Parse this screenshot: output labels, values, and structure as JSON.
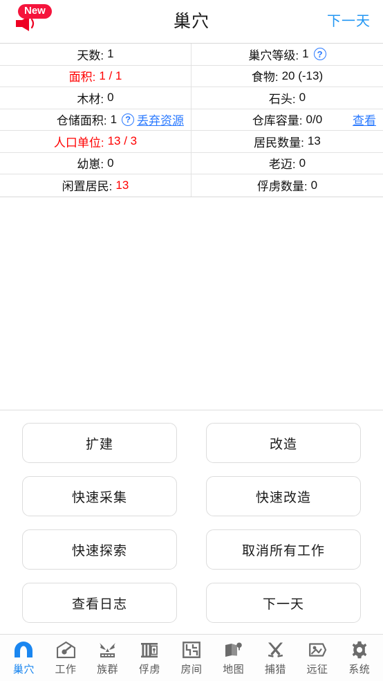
{
  "header": {
    "title": "巢穴",
    "next_day_label": "下一天",
    "badge": "New",
    "badge_icon": "megaphone-icon",
    "badge_color": "#f5143c",
    "link_color": "#2196f3"
  },
  "stats": {
    "help_glyph": "?",
    "rows": [
      {
        "left": {
          "label": "天数:",
          "value": "1",
          "alert": false,
          "help": false,
          "link": null
        },
        "right": {
          "label": "巢穴等级:",
          "value": "1",
          "alert": false,
          "help": true,
          "link": null
        }
      },
      {
        "left": {
          "label": "面积:",
          "value": "1 / 1",
          "alert": true,
          "help": false,
          "link": null
        },
        "right": {
          "label": "食物:",
          "value": "20 (-13)",
          "alert": false,
          "help": false,
          "link": null
        }
      },
      {
        "left": {
          "label": "木材:",
          "value": "0",
          "alert": false,
          "help": false,
          "link": null
        },
        "right": {
          "label": "石头:",
          "value": "0",
          "alert": false,
          "help": false,
          "link": null
        }
      },
      {
        "left": {
          "label": "仓储面积:",
          "value": "1",
          "alert": false,
          "help": true,
          "link": "丢弃资源"
        },
        "right": {
          "label": "仓库容量:",
          "value": "0/0",
          "alert": false,
          "help": false,
          "link": "查看"
        }
      },
      {
        "left": {
          "label": "人口单位:",
          "value": "13 / 3",
          "alert": true,
          "help": false,
          "link": null
        },
        "right": {
          "label": "居民数量:",
          "value": "13",
          "alert": false,
          "help": false,
          "link": null
        }
      },
      {
        "left": {
          "label": "幼崽:",
          "value": "0",
          "alert": false,
          "help": false,
          "link": null
        },
        "right": {
          "label": "老迈:",
          "value": "0",
          "alert": false,
          "help": false,
          "link": null
        }
      },
      {
        "left": {
          "label": "闲置居民:",
          "value": "13",
          "alert": false,
          "help": false,
          "link": null,
          "value_alert": true
        },
        "right": {
          "label": "俘虏数量:",
          "value": "0",
          "alert": false,
          "help": false,
          "link": null
        }
      }
    ]
  },
  "actions": {
    "rows": [
      [
        {
          "label": "扩建"
        },
        {
          "label": "改造"
        }
      ],
      [
        {
          "label": "快速采集"
        },
        {
          "label": "快速改造"
        }
      ],
      [
        {
          "label": "快速探索"
        },
        {
          "label": "取消所有工作"
        }
      ],
      [
        {
          "label": "查看日志"
        },
        {
          "label": "下一天"
        }
      ]
    ]
  },
  "tabbar": {
    "active_color": "#1a86f0",
    "items": [
      {
        "label": "巢穴",
        "icon": "cave-arch-icon",
        "active": true
      },
      {
        "label": "工作",
        "icon": "house-tool-icon",
        "active": false
      },
      {
        "label": "族群",
        "icon": "tribe-mask-icon",
        "active": false
      },
      {
        "label": "俘虏",
        "icon": "prison-bars-icon",
        "active": false
      },
      {
        "label": "房间",
        "icon": "floorplan-icon",
        "active": false
      },
      {
        "label": "地图",
        "icon": "map-pin-icon",
        "active": false
      },
      {
        "label": "捕猎",
        "icon": "crossed-swords-icon",
        "active": false
      },
      {
        "label": "远征",
        "icon": "expedition-flag-icon",
        "active": false
      },
      {
        "label": "系统",
        "icon": "gear-icon",
        "active": false
      }
    ]
  }
}
